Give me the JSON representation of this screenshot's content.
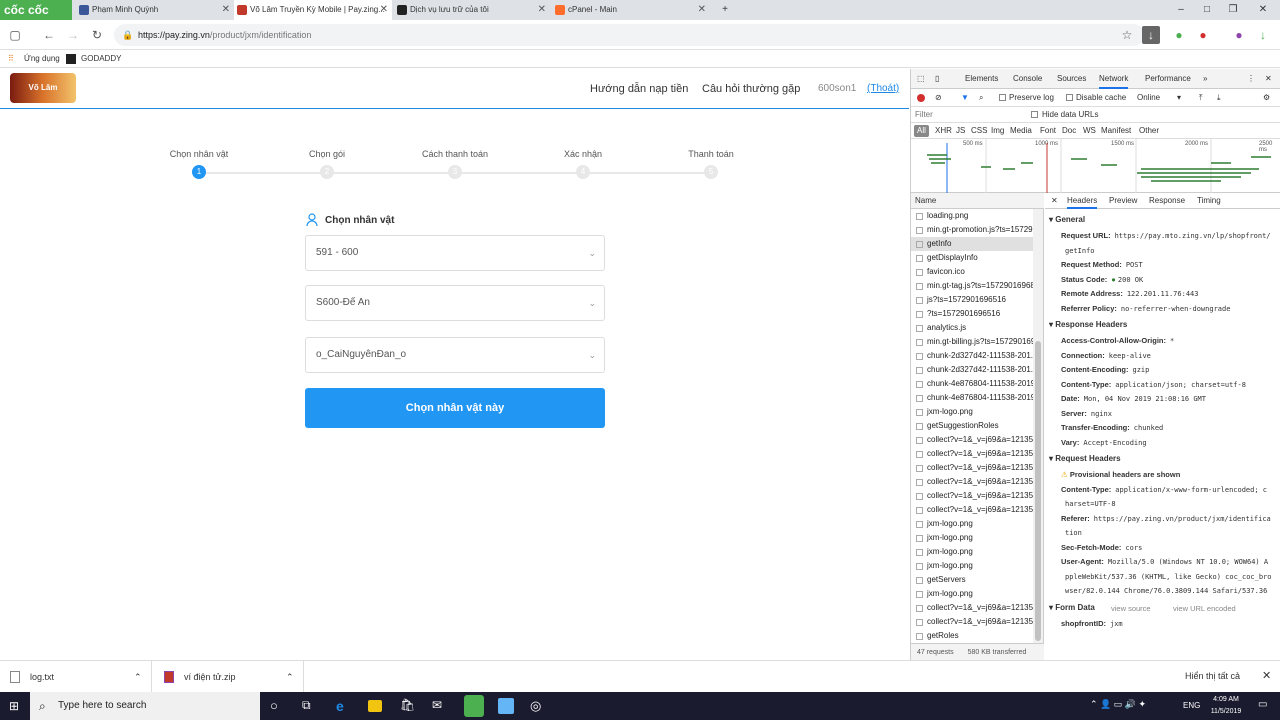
{
  "browser": {
    "brand": "cốc cốc",
    "tabs": [
      {
        "title": "Phạm Minh Quỳnh"
      },
      {
        "title": "Võ Lâm Truyền Kỳ Mobile | Pay.zing..."
      },
      {
        "title": "Dịch vụ lưu trữ của tôi"
      },
      {
        "title": "cPanel - Main"
      }
    ],
    "url_host": "https://pay.zing.vn",
    "url_path": "/product/jxm/identification",
    "bookmarks": [
      "Ứng dụng",
      "GODADDY"
    ]
  },
  "page": {
    "logo_text": "Võ Lâm",
    "nav": [
      "Hướng dẫn nạp tiền",
      "Câu hỏi thường gặp"
    ],
    "username": "600son1",
    "logout": "(Thoát)",
    "steps": [
      {
        "label": "Chọn nhân vật",
        "num": "1"
      },
      {
        "label": "Chọn gói",
        "num": "2"
      },
      {
        "label": "Cách thanh toán",
        "num": "3"
      },
      {
        "label": "Xác nhận",
        "num": "4"
      },
      {
        "label": "Thanh toán",
        "num": "5"
      }
    ],
    "form_title": "Chọn nhân vật",
    "selects": [
      "591 - 600",
      "S600-Đế An",
      "o_CaiNguyênĐan_o"
    ],
    "submit": "Chọn nhân vật này"
  },
  "devtools": {
    "tabs": [
      "Elements",
      "Console",
      "Sources",
      "Network",
      "Performance"
    ],
    "toolbar": {
      "preserve_log": "Preserve log",
      "disable_cache": "Disable cache",
      "throttle": "Online"
    },
    "filter_placeholder": "Filter",
    "hide_data_urls": "Hide data URLs",
    "types": [
      "All",
      "XHR",
      "JS",
      "CSS",
      "Img",
      "Media",
      "Font",
      "Doc",
      "WS",
      "Manifest",
      "Other"
    ],
    "ticks": [
      "500 ms",
      "1000 ms",
      "1500 ms",
      "2000 ms",
      "2500 ms"
    ],
    "name_header": "Name",
    "requests": [
      "loading.png",
      "min.gt-promotion.js?ts=15729",
      "getInfo",
      "getDisplayInfo",
      "favicon.ico",
      "min.gt-tag.js?ts=157290169684",
      "js?ts=1572901696516",
      "?ts=1572901696516",
      "analytics.js",
      "min.gt-billing.js?ts=157290169",
      "chunk-2d327d42-111538-201...",
      "chunk-2d327d42-111538-201...",
      "chunk-4e876804-111538-2019",
      "chunk-4e876804-111538-2019",
      "jxm-logo.png",
      "getSuggestionRoles",
      "collect?v=1&_v=j69&a=12135",
      "collect?v=1&_v=j69&a=12135",
      "collect?v=1&_v=j69&a=12135",
      "collect?v=1&_v=j69&a=12135",
      "collect?v=1&_v=j69&a=12135",
      "collect?v=1&_v=j69&a=12135",
      "jxm-logo.png",
      "jxm-logo.png",
      "jxm-logo.png",
      "jxm-logo.png",
      "getServers",
      "jxm-logo.png",
      "collect?v=1&_v=j69&a=12135",
      "collect?v=1&_v=j69&a=12135",
      "getRoles"
    ],
    "footer_requests": "47 requests",
    "footer_transferred": "580 KB transferred",
    "detail_tabs": [
      "Headers",
      "Preview",
      "Response",
      "Timing"
    ],
    "general_title": "General",
    "general": [
      {
        "k": "Request URL:",
        "v": "https://pay.mto.zing.vn/lp/shopfront/"
      },
      {
        "k": "",
        "v": "getInfo"
      },
      {
        "k": "Request Method:",
        "v": "POST"
      },
      {
        "k": "Status Code:",
        "v": "200 OK"
      },
      {
        "k": "Remote Address:",
        "v": "122.201.11.76:443"
      },
      {
        "k": "Referrer Policy:",
        "v": "no-referrer-when-downgrade"
      }
    ],
    "response_title": "Response Headers",
    "response": [
      {
        "k": "Access-Control-Allow-Origin:",
        "v": "*"
      },
      {
        "k": "Connection:",
        "v": "keep-alive"
      },
      {
        "k": "Content-Encoding:",
        "v": "gzip"
      },
      {
        "k": "Content-Type:",
        "v": "application/json; charset=utf-8"
      },
      {
        "k": "Date:",
        "v": "Mon, 04 Nov 2019 21:08:16 GMT"
      },
      {
        "k": "Server:",
        "v": "nginx"
      },
      {
        "k": "Transfer-Encoding:",
        "v": "chunked"
      },
      {
        "k": "Vary:",
        "v": "Accept-Encoding"
      }
    ],
    "request_title": "Request Headers",
    "provisional": "Provisional headers are shown",
    "request": [
      {
        "k": "Content-Type:",
        "v": "application/x-www-form-urlencoded; c"
      },
      {
        "k": "",
        "v": "harset=UTF-8"
      },
      {
        "k": "Referer:",
        "v": "https://pay.zing.vn/product/jxm/identifica"
      },
      {
        "k": "",
        "v": "tion"
      },
      {
        "k": "Sec-Fetch-Mode:",
        "v": "cors"
      },
      {
        "k": "User-Agent:",
        "v": "Mozilla/5.0 (Windows NT 10.0; WOW64) A"
      },
      {
        "k": "",
        "v": "ppleWebKit/537.36 (KHTML, like Gecko) coc_coc_bro"
      },
      {
        "k": "",
        "v": "wser/82.0.144 Chrome/76.0.3809.144 Safari/537.36"
      }
    ],
    "form_title": "Form Data",
    "view_source": "view source",
    "view_url_encoded": "view URL encoded",
    "form": [
      {
        "k": "shopfrontID:",
        "v": "jxm"
      }
    ]
  },
  "downloads": {
    "items": [
      "log.txt",
      "ví điện tử.zip"
    ],
    "show_all": "Hiển thị tất cả"
  },
  "taskbar": {
    "search": "Type here to search",
    "lang": "ENG",
    "time": "4:09 AM",
    "date": "11/5/2019"
  }
}
